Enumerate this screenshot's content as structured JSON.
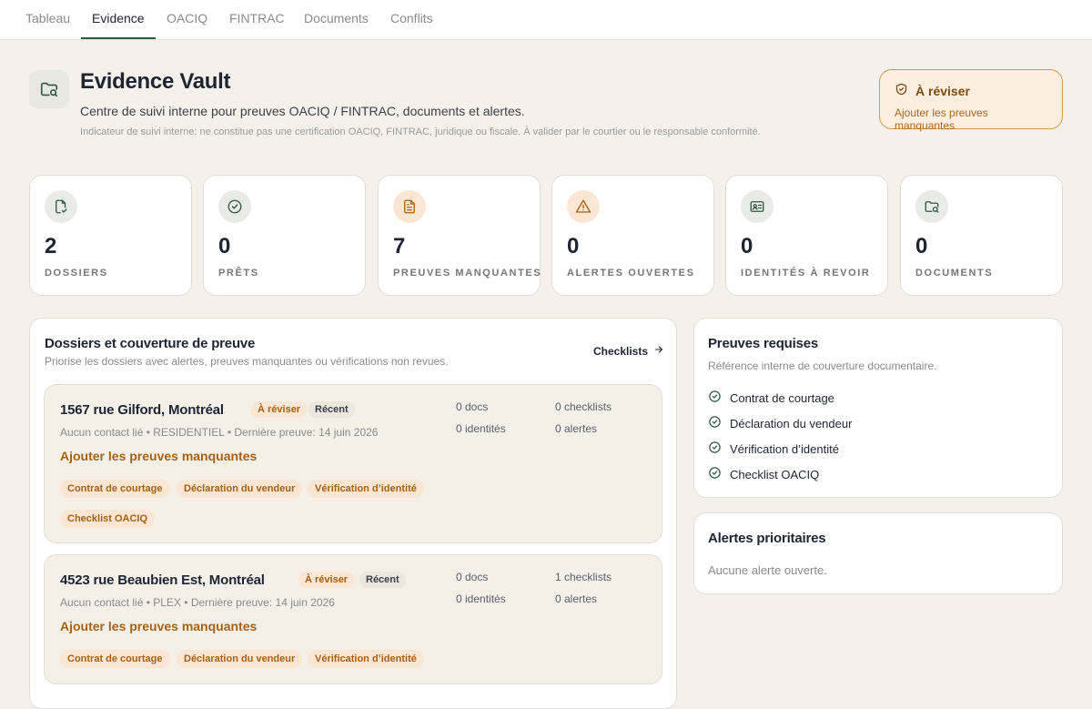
{
  "nav": {
    "tabs": [
      "Tableau",
      "Evidence",
      "OACIQ",
      "FINTRAC",
      "Documents",
      "Conflits"
    ]
  },
  "header": {
    "icon": "folder-search-icon",
    "title": "Evidence Vault",
    "subtitle": "Centre de suivi interne pour preuves OACIQ / FINTRAC, documents et alertes.",
    "disclaimer": "Indicateur de suivi interne: ne constitue pas une certification OACIQ, FINTRAC, juridique ou fiscale. À valider par le courtier ou le responsable conformité."
  },
  "review": {
    "icon": "shield-check-icon",
    "title": "À réviser",
    "subtitle": "Ajouter les preuves manquantes"
  },
  "stats": [
    {
      "icon": "file-check-icon",
      "value": "2",
      "label": "DOSSIERS"
    },
    {
      "icon": "circle-check-icon",
      "value": "0",
      "label": "PRÊTS"
    },
    {
      "icon": "document-icon",
      "value": "7",
      "label": "PREUVES MANQUANTES"
    },
    {
      "icon": "warning-icon",
      "value": "0",
      "label": "ALERTES OUVERTES"
    },
    {
      "icon": "id-card-icon",
      "value": "0",
      "label": "IDENTITÉS À REVOIR"
    },
    {
      "icon": "folder-search-icon",
      "value": "0",
      "label": "DOCUMENTS"
    }
  ],
  "dossiers_panel": {
    "title": "Dossiers et couverture de preuve",
    "subtitle": "Priorise les dossiers avec alertes, preuves manquantes ou vérifications non revues.",
    "link": "Checklists",
    "items": [
      {
        "address": "1567 rue Gilford, Montréal",
        "badge_status": "À réviser",
        "badge_recent": "Récent",
        "meta": "Aucun contact lié • RESIDENTIEL • Dernière preuve: 14 juin 2026",
        "cta": "Ajouter les preuves manquantes",
        "docs": "0 docs",
        "checklists": "0 checklists",
        "identities": "0 identités",
        "alerts": "0 alertes",
        "missing": [
          "Contrat de courtage",
          "Déclaration du vendeur",
          "Vérification d’identité",
          "Checklist OACIQ"
        ]
      },
      {
        "address": "4523 rue Beaubien Est, Montréal",
        "badge_status": "À réviser",
        "badge_recent": "Récent",
        "meta": "Aucun contact lié • PLEX • Dernière preuve: 14 juin 2026",
        "cta": "Ajouter les preuves manquantes",
        "docs": "0 docs",
        "checklists": "1 checklists",
        "identities": "0 identités",
        "alerts": "0 alertes",
        "missing": [
          "Contrat de courtage",
          "Déclaration du vendeur",
          "Vérification d’identité"
        ]
      }
    ]
  },
  "required": {
    "title": "Preuves requises",
    "subtitle": "Référence interne de couverture documentaire.",
    "items": [
      "Contrat de courtage",
      "Déclaration du vendeur",
      "Vérification d’identité",
      "Checklist OACIQ"
    ]
  },
  "alerts": {
    "title": "Alertes prioritaires",
    "empty": "Aucune alerte ouverte."
  },
  "colors": {
    "accent_green": "#2f5940",
    "warning_orange": "#a8600f",
    "background": "#f5f1ea"
  }
}
